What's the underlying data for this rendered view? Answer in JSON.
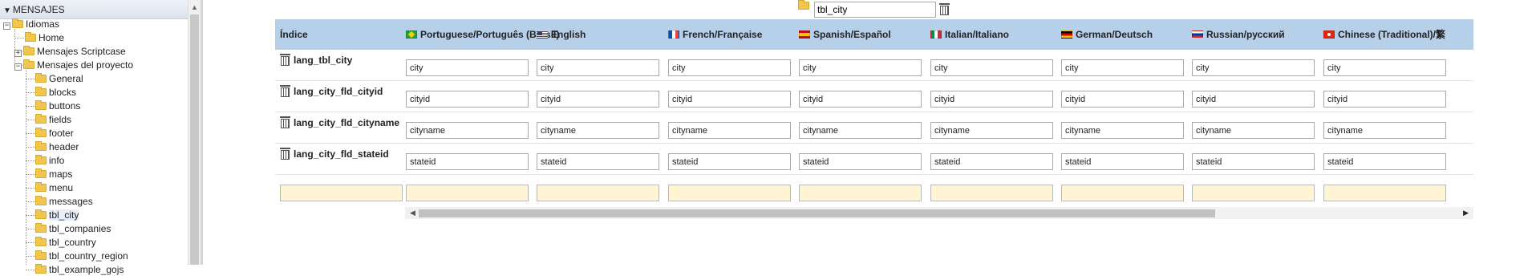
{
  "tree": {
    "header": "MENSAJES",
    "root": "Idiomas",
    "items": [
      {
        "label": "Home",
        "level": 1,
        "expandable": false
      },
      {
        "label": "Mensajes Scriptcase",
        "level": 1,
        "expandable": true,
        "expanded": false
      },
      {
        "label": "Mensajes del proyecto",
        "level": 1,
        "expandable": true,
        "expanded": true
      },
      {
        "label": "General",
        "level": 2
      },
      {
        "label": "blocks",
        "level": 2
      },
      {
        "label": "buttons",
        "level": 2
      },
      {
        "label": "fields",
        "level": 2
      },
      {
        "label": "footer",
        "level": 2
      },
      {
        "label": "header",
        "level": 2
      },
      {
        "label": "info",
        "level": 2
      },
      {
        "label": "maps",
        "level": 2
      },
      {
        "label": "menu",
        "level": 2
      },
      {
        "label": "messages",
        "level": 2
      },
      {
        "label": "tbl_city",
        "level": 2,
        "selected": true
      },
      {
        "label": "tbl_companies",
        "level": 2
      },
      {
        "label": "tbl_country",
        "level": 2
      },
      {
        "label": "tbl_country_region",
        "level": 2
      },
      {
        "label": "tbl_example_gojs",
        "level": 2
      }
    ]
  },
  "file_bar": {
    "value": "tbl_city"
  },
  "grid": {
    "index_header": "Índice",
    "columns": [
      {
        "label": "Portuguese/Português (Brasil)",
        "flag": "br"
      },
      {
        "label": "English",
        "flag": "us"
      },
      {
        "label": "French/Française",
        "flag": "fr"
      },
      {
        "label": "Spanish/Español",
        "flag": "es"
      },
      {
        "label": "Italian/Italiano",
        "flag": "it"
      },
      {
        "label": "German/Deutsch",
        "flag": "de"
      },
      {
        "label": "Russian/русский",
        "flag": "ru"
      },
      {
        "label": "Chinese (Traditional)/繁",
        "flag": "hk"
      }
    ],
    "rows": [
      {
        "key": "lang_tbl_city",
        "values": [
          "city",
          "city",
          "city",
          "city",
          "city",
          "city",
          "city",
          "city"
        ]
      },
      {
        "key": "lang_city_fld_cityid",
        "values": [
          "cityid",
          "cityid",
          "cityid",
          "cityid",
          "cityid",
          "cityid",
          "cityid",
          "cityid"
        ]
      },
      {
        "key": "lang_city_fld_cityname",
        "values": [
          "cityname",
          "cityname",
          "cityname",
          "cityname",
          "cityname",
          "cityname",
          "cityname",
          "cityname"
        ]
      },
      {
        "key": "lang_city_fld_stateid",
        "values": [
          "stateid",
          "stateid",
          "stateid",
          "stateid",
          "stateid",
          "stateid",
          "stateid",
          "stateid"
        ]
      }
    ]
  },
  "colors": {
    "header_bg": "#b7d0ea",
    "new_row_input_bg": "#fff5d5",
    "folder": "#f0c64e"
  }
}
